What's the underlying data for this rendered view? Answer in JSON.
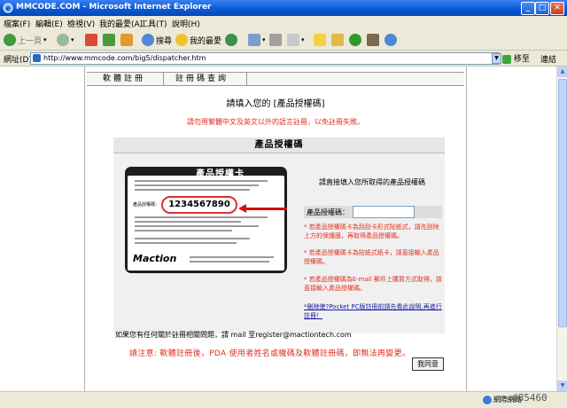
{
  "window": {
    "title": "MMCODE.COM - Microsoft Internet Explorer"
  },
  "menu": [
    "檔案(F)",
    "編輯(E)",
    "檢視(V)",
    "我的最愛(A)",
    "工具(T)",
    "說明(H)"
  ],
  "toolbar": {
    "back": "上一頁",
    "search": "搜尋",
    "favorites": "我的最愛"
  },
  "address": {
    "label": "網址(D)",
    "url": "http://www.mmcode.com/big5/dispatcher.htm",
    "go": "移至",
    "links": "連結"
  },
  "page": {
    "tabs": [
      "軟體註冊",
      "註冊碼查詢"
    ],
    "prompt": "請填入您的 [產品授權碼]",
    "warning": "請勿用繁體中文及英文以外的語言註冊，以免註冊失敗。",
    "panel_title": "產品授權碼",
    "card": {
      "title": "產品授權卡",
      "code_label": "產品授權碼：",
      "code": "1234567890",
      "logo": "Maction"
    },
    "instruction": "請直接填入您所取得的產品授權碼",
    "code_label": "產品授權碼：",
    "notes": [
      "* 若產品授權碼卡為刮刮卡形式貼紙式，請先刮除上方的保護膜，再取得產品授權碼。",
      "* 若產品授權碼卡為貼紙式紙卡，請直接輸入產品授權碼。",
      "* 若產品授權碼為E-mail 郵件上購買方式取得，請直接輸入產品授權碼。"
    ],
    "help_link": "*刪除使?Pocket PC版註冊前請先看此說明,再進行註冊！",
    "contact": "如果您有任何關於註冊相關問題，請 mail 至register@mactiontech.com",
    "final_warning": "請注意: 軟體註冊後，PDA 使用者姓名或機碼及軟體註冊碼，即無法再變更。",
    "agree_button": "我同意"
  },
  "status": {
    "zone": "網際網路"
  },
  "watermark": "#85460"
}
